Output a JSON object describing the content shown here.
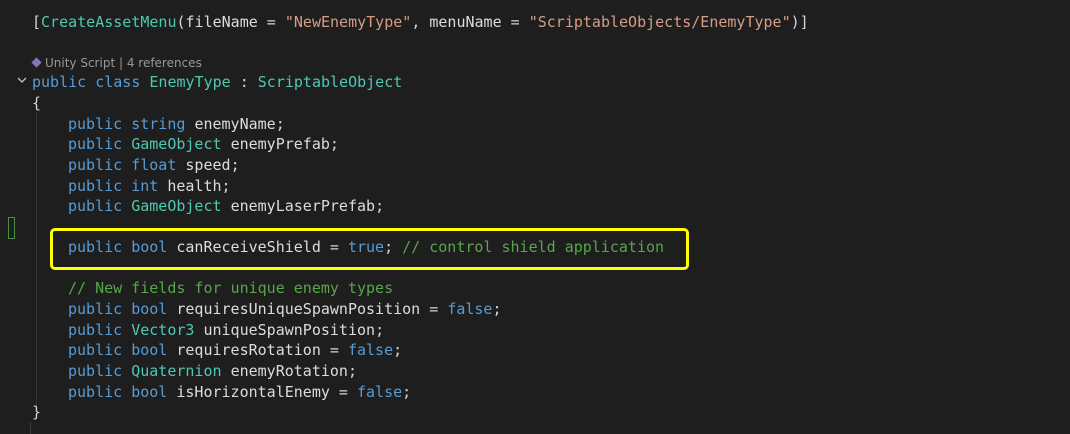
{
  "attribute_line": {
    "open_bracket": "[",
    "attr_name": "CreateAssetMenu",
    "open_paren": "(",
    "filename_key": "fileName",
    "eq1": " = ",
    "filename_value": "\"NewEnemyType\"",
    "comma": ", ",
    "menuname_key": "menuName",
    "eq2": " = ",
    "menuname_value": "\"ScriptableObjects/EnemyType\"",
    "close": ")]"
  },
  "codelens": {
    "text": "Unity Script | 4 references"
  },
  "class_decl": {
    "kw_public": "public",
    "kw_class": "class",
    "class_name": "EnemyType",
    "colon": " : ",
    "base_class": "ScriptableObject"
  },
  "braces": {
    "open": "{",
    "close": "}"
  },
  "fields": [
    {
      "mod": "public",
      "type": "string",
      "name": "enemyName",
      "tail": ";"
    },
    {
      "mod": "public",
      "type": "GameObject",
      "name": "enemyPrefab",
      "tail": ";"
    },
    {
      "mod": "public",
      "type": "float",
      "name": "speed",
      "tail": ";"
    },
    {
      "mod": "public",
      "type": "int",
      "name": "health",
      "tail": ";"
    },
    {
      "mod": "public",
      "type": "GameObject",
      "name": "enemyLaserPrefab",
      "tail": ";"
    }
  ],
  "highlighted_line": {
    "mod": "public",
    "type": "bool",
    "name": "canReceiveShield",
    "eq": " = ",
    "value": "true",
    "semi": ";",
    "comment": "// control shield application"
  },
  "comment_line": "// New fields for unique enemy types",
  "unique_fields": [
    {
      "mod": "public",
      "type": "bool",
      "name": "requiresUniqueSpawnPosition",
      "eq": " = ",
      "value": "false",
      "semi": ";"
    },
    {
      "mod": "public",
      "type": "Vector3",
      "name": "uniqueSpawnPosition",
      "eq": "",
      "value": "",
      "semi": ";"
    },
    {
      "mod": "public",
      "type": "bool",
      "name": "requiresRotation",
      "eq": " = ",
      "value": "false",
      "semi": ";"
    },
    {
      "mod": "public",
      "type": "Quaternion",
      "name": "enemyRotation",
      "eq": "",
      "value": "",
      "semi": ";"
    },
    {
      "mod": "public",
      "type": "bool",
      "name": "isHorizontalEnemy",
      "eq": " = ",
      "value": "false",
      "semi": ";"
    }
  ],
  "colors": {
    "background": "#1e1e1e",
    "keyword": "#569cd6",
    "type": "#4ec9b0",
    "string": "#d69d85",
    "comment": "#57a64a",
    "highlight_border": "#ffff00"
  }
}
